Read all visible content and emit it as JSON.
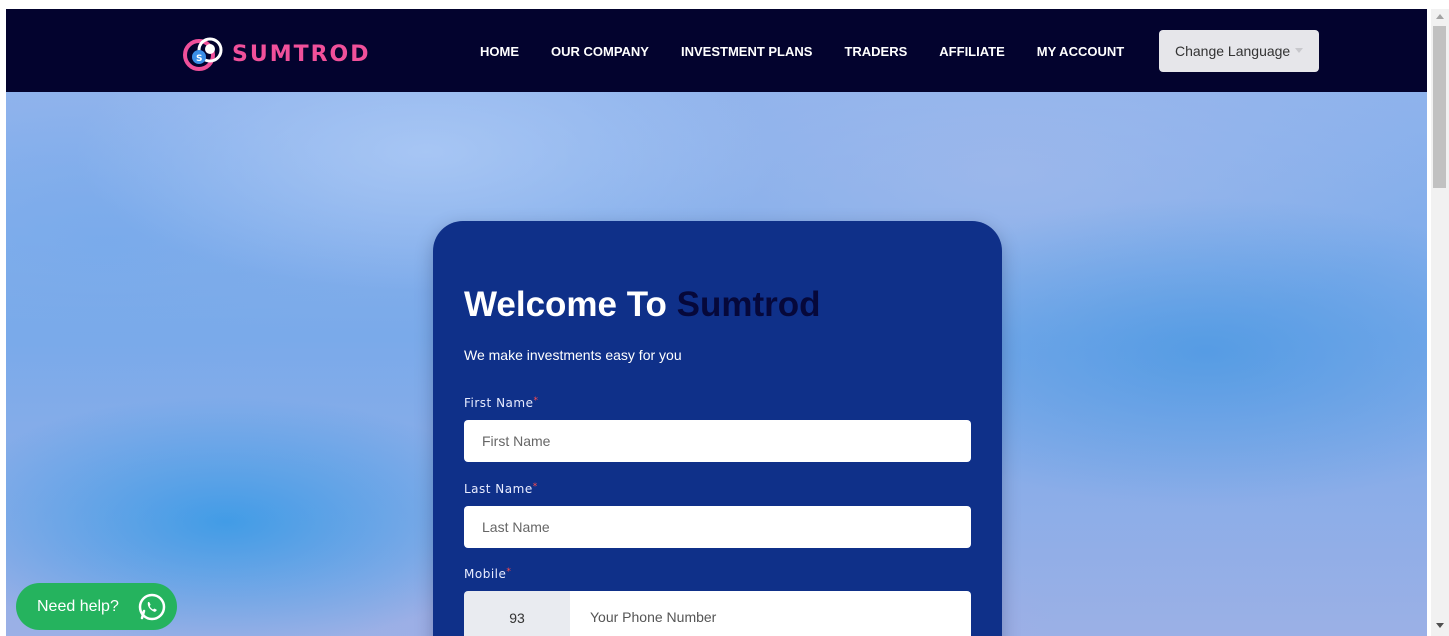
{
  "header": {
    "brand": "SUMTROD",
    "nav": [
      {
        "label": "HOME"
      },
      {
        "label": "OUR COMPANY"
      },
      {
        "label": "INVESTMENT PLANS"
      },
      {
        "label": "TRADERS"
      },
      {
        "label": "AFFILIATE"
      },
      {
        "label": "MY ACCOUNT"
      }
    ],
    "language_button": "Change Language"
  },
  "form": {
    "title_prefix": "Welcome To",
    "title_brand": "Sumtrod",
    "subtitle": "We make investments easy for you",
    "first_name_label": "First Name",
    "first_name_placeholder": "First Name",
    "last_name_label": "Last Name",
    "last_name_placeholder": "Last Name",
    "mobile_label": "Mobile",
    "required_mark": "*",
    "country_code": "93",
    "phone_placeholder": "Your Phone Number"
  },
  "help": {
    "label": "Need help?"
  },
  "colors": {
    "navbar": "#03032e",
    "brand_pink": "#f0509a",
    "card": "#0f3089",
    "help_green": "#25b35e"
  },
  "icons": {
    "logo": "sumtrod-logo-icon",
    "whatsapp": "whatsapp-icon",
    "dropdown": "caret-down-icon"
  }
}
